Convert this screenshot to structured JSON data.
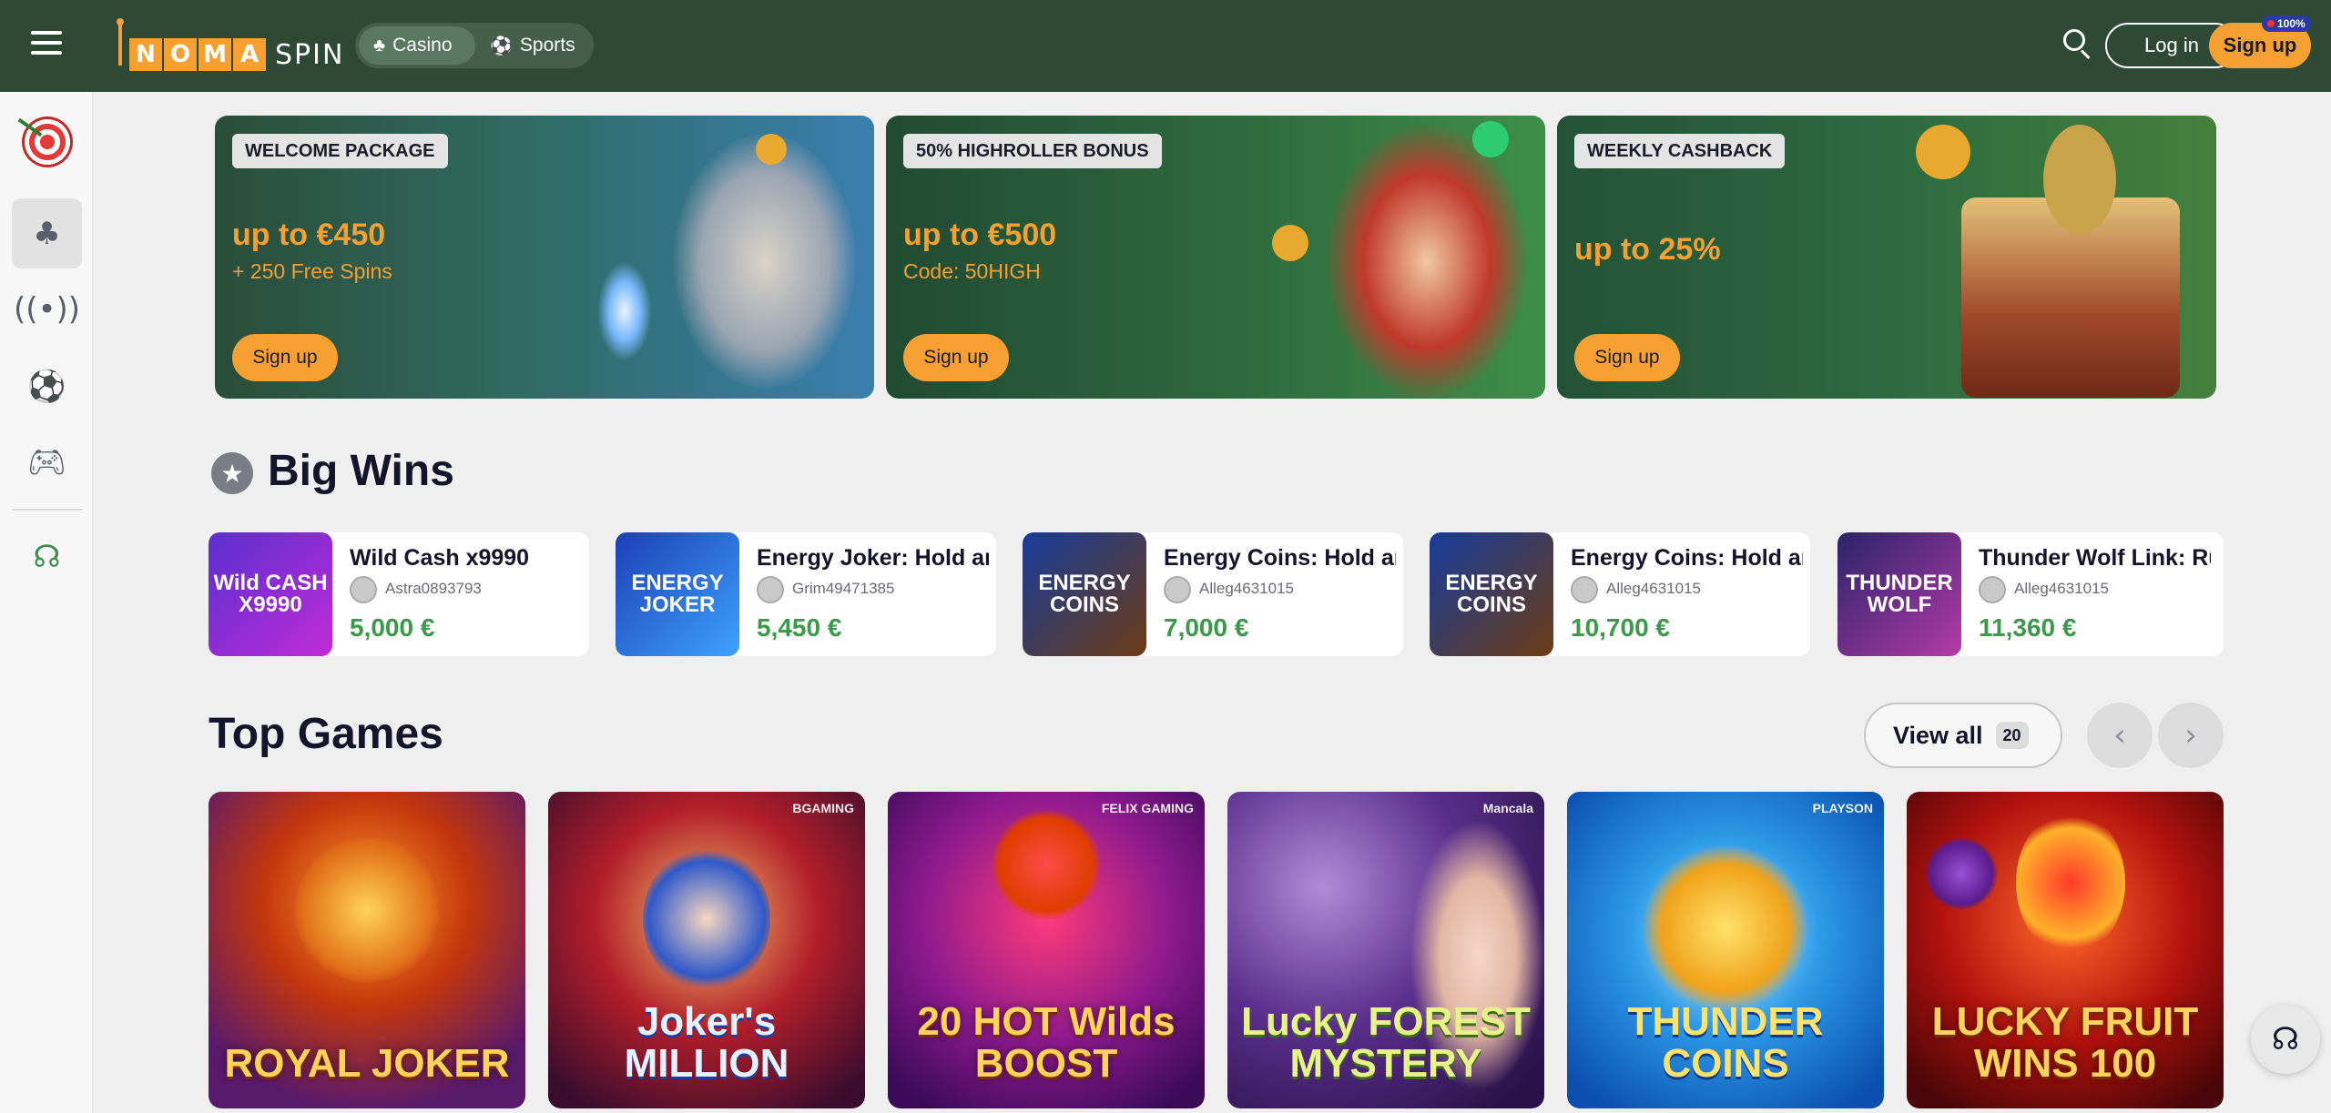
{
  "header": {
    "brand_letters": [
      "N",
      "O",
      "M",
      "A"
    ],
    "brand_suffix": "SPIN",
    "tabs": [
      {
        "label": "Casino",
        "active": true
      },
      {
        "label": "Sports",
        "active": false
      }
    ],
    "login_label": "Log in",
    "signup_label": "Sign up",
    "signup_badge": "100%"
  },
  "sidebar": {
    "items": [
      {
        "icon": "target-icon"
      },
      {
        "icon": "cherries-icon",
        "active": true
      },
      {
        "icon": "live-broadcast-icon"
      },
      {
        "icon": "football-icon"
      },
      {
        "icon": "gamepad-icon"
      },
      {
        "icon": "headset-icon"
      }
    ]
  },
  "promos": [
    {
      "tag": "WELCOME PACKAGE",
      "amount": "up to €450",
      "sub": "+ 250 Free Spins",
      "button": "Sign up"
    },
    {
      "tag": "50% HIGHROLLER BONUS",
      "amount": "up to €500",
      "sub": "Code: 50HIGH",
      "button": "Sign up"
    },
    {
      "tag": "WEEKLY CASHBACK",
      "amount": "up to 25%",
      "sub": "",
      "button": "Sign up"
    }
  ],
  "big_wins": {
    "title": "Big Wins",
    "items": [
      {
        "game": "Wild Cash x9990",
        "thumb": "Wild CASH X9990",
        "user": "Astra0893793",
        "amount": "5,000 €"
      },
      {
        "game": "Energy Joker: Hold and Win",
        "thumb": "ENERGY JOKER",
        "user": "Grim49471385",
        "amount": "5,450 €"
      },
      {
        "game": "Energy Coins: Hold and Win",
        "thumb": "ENERGY COINS",
        "user": "Alleg4631015",
        "amount": "7,000 €"
      },
      {
        "game": "Energy Coins: Hold and Win",
        "thumb": "ENERGY COINS",
        "user": "Alleg4631015",
        "amount": "10,700 €"
      },
      {
        "game": "Thunder Wolf Link: Running Wins",
        "thumb": "THUNDER WOLF",
        "user": "Alleg4631015",
        "amount": "11,360 €"
      }
    ]
  },
  "top_games": {
    "title": "Top Games",
    "view_all_label": "View all",
    "view_all_count": "20",
    "games": [
      {
        "title": "ROYAL JOKER",
        "provider": ""
      },
      {
        "title": "Joker's MILLION",
        "provider": "BGAMING"
      },
      {
        "title": "20 HOT Wilds BOOST",
        "provider": "FELIX GAMING"
      },
      {
        "title": "Lucky FOREST MYSTERY",
        "provider": "Mancala"
      },
      {
        "title": "THUNDER COINS",
        "provider": "PLAYSON"
      },
      {
        "title": "LUCKY FRUIT WINS 100",
        "provider": ""
      }
    ]
  },
  "colors": {
    "header_bg": "#2e4a36",
    "accent": "#f5a030",
    "win_green": "#3a9a48"
  }
}
